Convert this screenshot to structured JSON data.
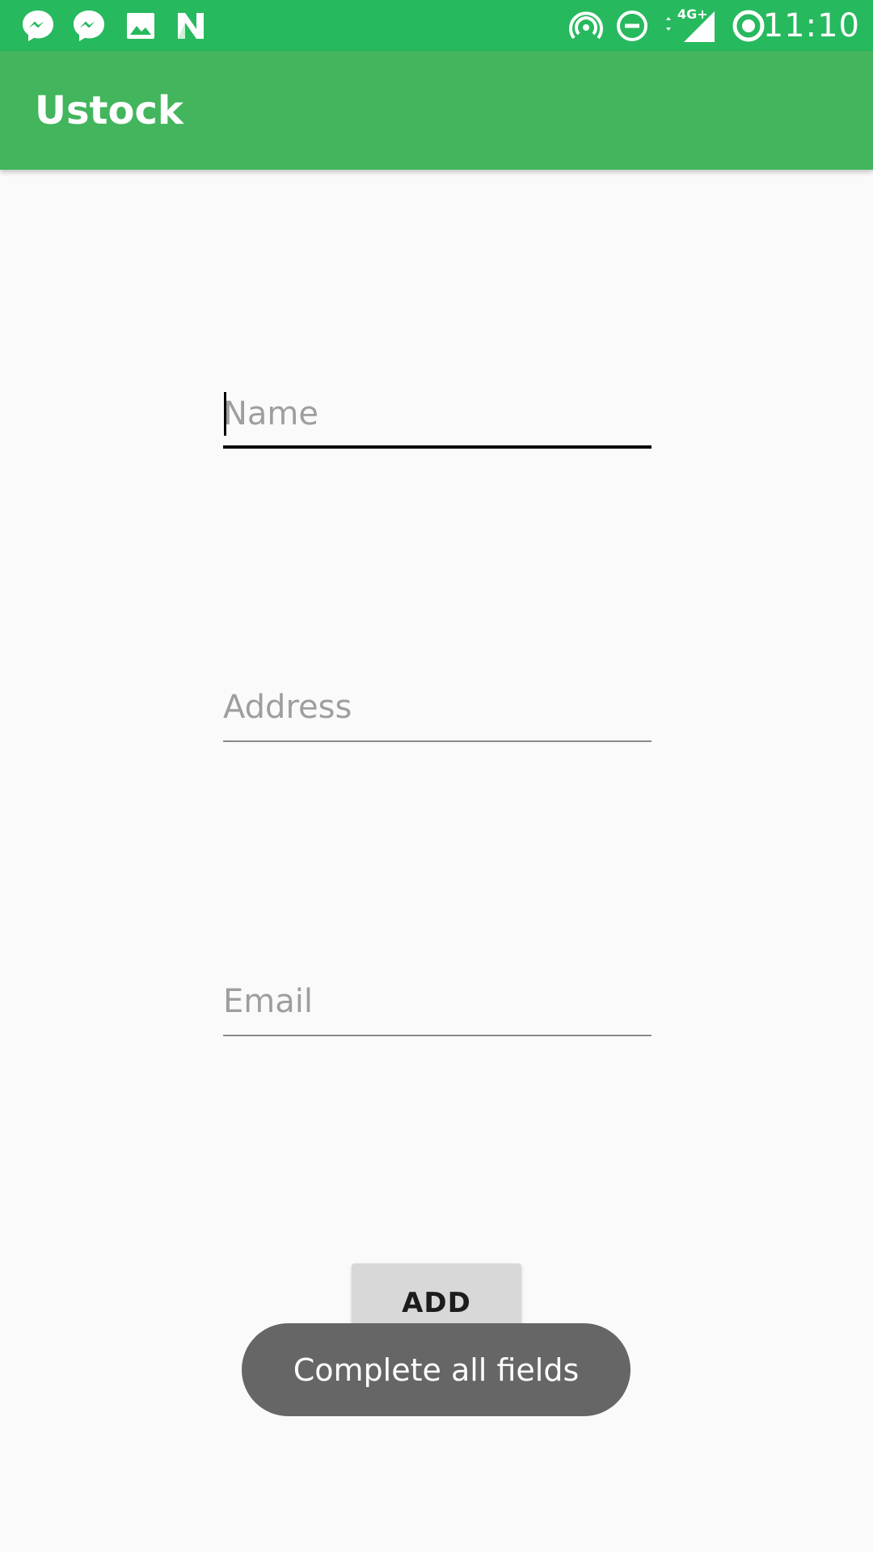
{
  "status_bar": {
    "time": "11:10",
    "network": "4G+",
    "left_icons": [
      "messenger-icon",
      "messenger-icon",
      "gallery-icon",
      "n-app-icon"
    ],
    "right_icons": [
      "hotspot-icon",
      "do-not-disturb-icon",
      "signal-icon",
      "sync-icon"
    ],
    "color": "#27b95e"
  },
  "app_bar": {
    "title": "Ustock",
    "color": "#42b55d"
  },
  "form": {
    "name": {
      "placeholder": "Name",
      "value": ""
    },
    "address": {
      "placeholder": "Address",
      "value": ""
    },
    "email": {
      "placeholder": "Email",
      "value": ""
    },
    "add_label": "ADD"
  },
  "toast": {
    "message": "Complete all fields"
  }
}
